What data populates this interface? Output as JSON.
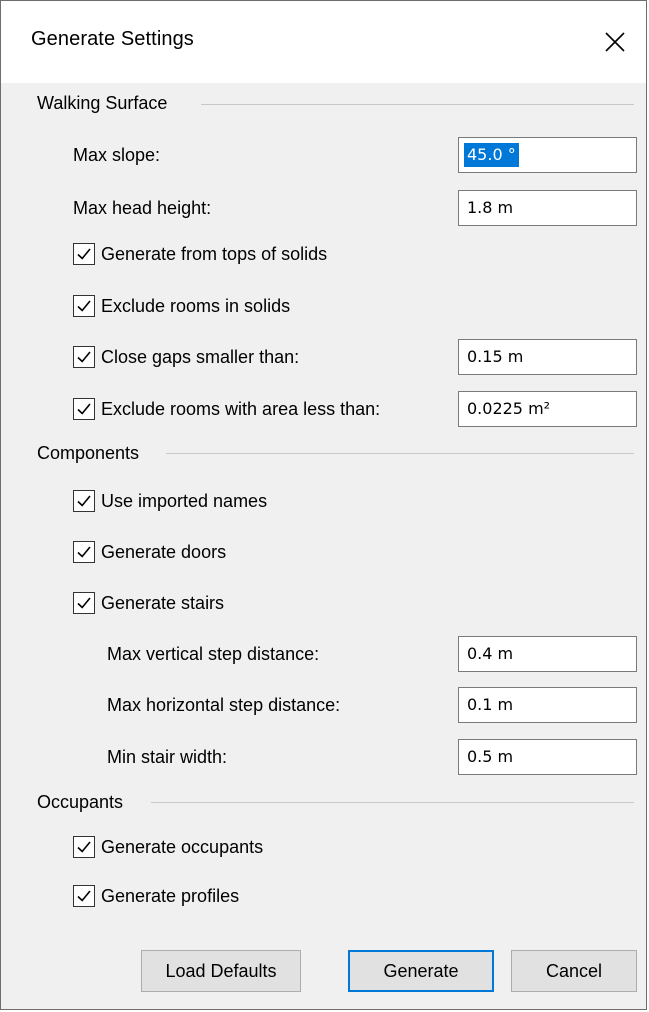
{
  "window": {
    "title": "Generate Settings"
  },
  "walking_surface": {
    "heading": "Walking Surface",
    "max_slope_label": "Max slope:",
    "max_slope_value": "45.0 °",
    "max_head_height_label": "Max head height:",
    "max_head_height_value": "1.8 m",
    "gen_tops_label": "Generate from tops of solids",
    "exclude_rooms_solids_label": "Exclude rooms in solids",
    "close_gaps_label": "Close gaps smaller than:",
    "close_gaps_value": "0.15 m",
    "exclude_area_label": "Exclude rooms with area less than:",
    "exclude_area_value": "0.0225 m²"
  },
  "components": {
    "heading": "Components",
    "use_imported_label": "Use imported names",
    "gen_doors_label": "Generate doors",
    "gen_stairs_label": "Generate stairs",
    "max_vertical_label": "Max vertical step distance:",
    "max_vertical_value": "0.4 m",
    "max_horizontal_label": "Max horizontal step distance:",
    "max_horizontal_value": "0.1 m",
    "min_stair_label": "Min stair width:",
    "min_stair_value": "0.5 m"
  },
  "occupants": {
    "heading": "Occupants",
    "gen_occupants_label": "Generate occupants",
    "gen_profiles_label": "Generate profiles"
  },
  "buttons": {
    "load_defaults": "Load Defaults",
    "generate": "Generate",
    "cancel": "Cancel"
  }
}
